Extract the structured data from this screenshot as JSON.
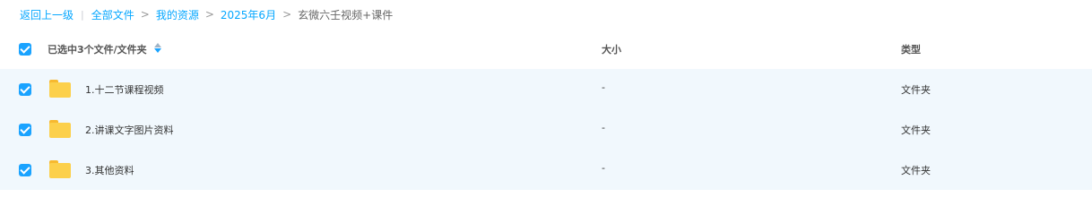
{
  "breadcrumb": {
    "back": "返回上一级",
    "all_files": "全部文件",
    "my_resources": "我的资源",
    "month": "2025年6月",
    "current": "玄微六壬视频+课件",
    "sep_bar": "|",
    "sep_gt": ">"
  },
  "header": {
    "name_label": "已选中3个文件/文件夹",
    "size_label": "大小",
    "type_label": "类型"
  },
  "files": [
    {
      "name": "1.十二节课程视频",
      "size": "-",
      "type": "文件夹"
    },
    {
      "name": "2.讲课文字图片资料",
      "size": "-",
      "type": "文件夹"
    },
    {
      "name": "3.其他资料",
      "size": "-",
      "type": "文件夹"
    }
  ],
  "colors": {
    "accent": "#06a7ff",
    "checkbox": "#1aa3ff",
    "row_selected_bg": "#f1f8fd",
    "folder": "#fcd04b"
  }
}
